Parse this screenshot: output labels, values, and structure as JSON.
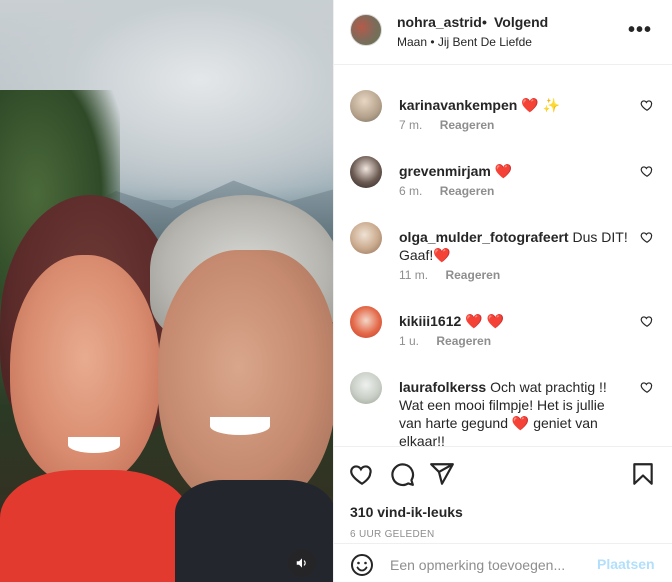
{
  "post": {
    "username": "nohra_astrid",
    "separator": "•",
    "follow_label": "Volgend",
    "audio": "Maan • Jij Bent De Liefde",
    "more_label": "•••"
  },
  "comments": [
    {
      "user": "karinavankempen",
      "text": "❤️ ✨",
      "time": "7 m.",
      "reply": "Reageren"
    },
    {
      "user": "grevenmirjam",
      "text": "❤️",
      "time": "6 m.",
      "reply": "Reageren"
    },
    {
      "user": "olga_mulder_fotografeert",
      "text": "Dus DIT! Gaaf!❤️",
      "time": "11 m.",
      "reply": "Reageren"
    },
    {
      "user": "kikiii1612",
      "text": "❤️ ❤️",
      "time": "1 u.",
      "reply": "Reageren"
    },
    {
      "user": "laurafolkerss",
      "text": "Och wat prachtig !! Wat een mooi filmpje! Het is jullie van harte gegund ❤️  geniet van elkaar!!",
      "time": "",
      "reply": ""
    }
  ],
  "actions": {
    "likes": "310 vind-ik-leuks",
    "time_ago": "6 UUR GELEDEN"
  },
  "add_comment": {
    "placeholder": "Een opmerking toevoegen...",
    "post_label": "Plaatsen"
  },
  "colors": {
    "accent_disabled": "#b2dffc",
    "heart_red": "#ed4956",
    "secondary_text": "#8e8e8e"
  },
  "icons": [
    "volume-icon",
    "more-icon",
    "heart-icon",
    "comment-icon",
    "share-icon",
    "bookmark-icon",
    "emoji-icon"
  ]
}
